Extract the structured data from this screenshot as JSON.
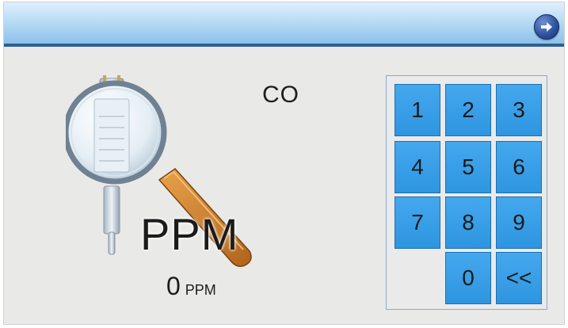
{
  "titlebar": {
    "next_button_icon": "arrow-right-icon"
  },
  "gas": {
    "name": "CO"
  },
  "probe": {
    "icon": "magnifier-probe-icon",
    "label": "PPM"
  },
  "reading": {
    "value": "0",
    "unit": "PPM"
  },
  "keypad": {
    "keys": [
      {
        "label": "1",
        "name": "key-1"
      },
      {
        "label": "2",
        "name": "key-2"
      },
      {
        "label": "3",
        "name": "key-3"
      },
      {
        "label": "4",
        "name": "key-4"
      },
      {
        "label": "5",
        "name": "key-5"
      },
      {
        "label": "6",
        "name": "key-6"
      },
      {
        "label": "7",
        "name": "key-7"
      },
      {
        "label": "8",
        "name": "key-8"
      },
      {
        "label": "9",
        "name": "key-9"
      },
      {
        "label": "0",
        "name": "key-0"
      },
      {
        "label": "<<",
        "name": "backspace-key"
      }
    ]
  },
  "colors": {
    "key_blue": "#2e95e0",
    "titlebar_blue": "#8cc1ea",
    "title_border": "#2e5f95",
    "screen_background": "#e9e9e7"
  }
}
